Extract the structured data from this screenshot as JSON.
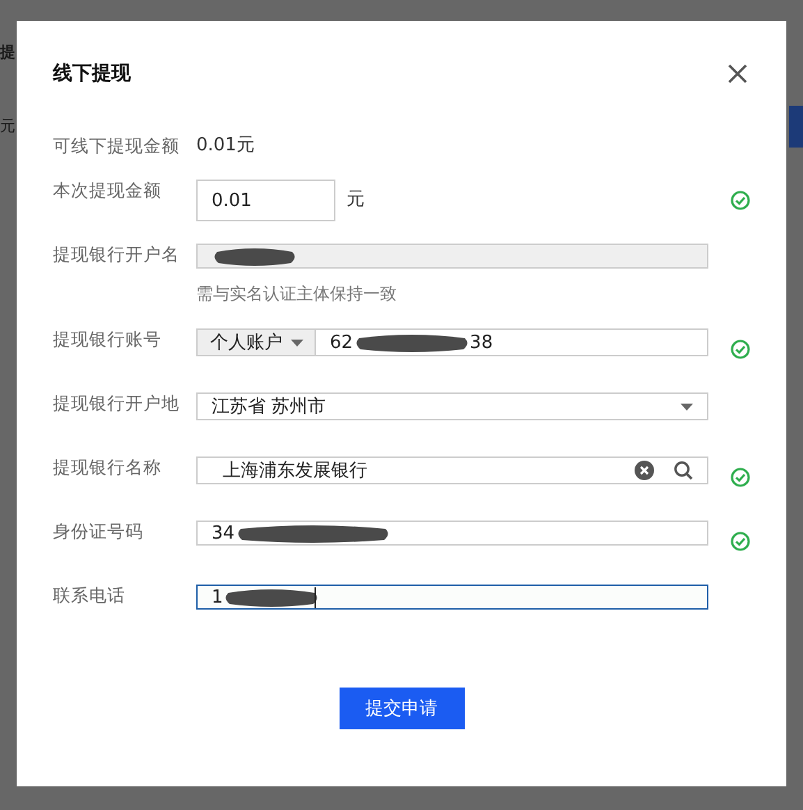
{
  "background": {
    "heading": "提",
    "amount_unit": "元"
  },
  "dialog": {
    "title": "线下提现"
  },
  "fields": [
    {
      "kind": "text",
      "label": "可线下提现金额",
      "value": "0.01元"
    },
    {
      "kind": "amount",
      "label": "本次提现金额",
      "value": "0.01",
      "unit": "元",
      "valid": true
    },
    {
      "kind": "readonly",
      "label": "提现银行开户名",
      "redacted": true,
      "hint": "需与实名认证主体保持一致",
      "valid": false
    },
    {
      "kind": "account",
      "label": "提现银行账号",
      "account_type": "个人账户",
      "value_start": "62",
      "redacted": true,
      "value_end": "38",
      "valid": true
    },
    {
      "kind": "select",
      "label": "提现银行开户地",
      "value": "江苏省 苏州市",
      "valid": false
    },
    {
      "kind": "search",
      "label": "提现银行名称",
      "value": "上海浦东发展银行",
      "valid": true
    },
    {
      "kind": "input",
      "label": "身份证号码",
      "value_start": "34",
      "redacted": true,
      "valid": true
    },
    {
      "kind": "input",
      "label": "联系电话",
      "value_start": "1",
      "redacted": true,
      "focused": true,
      "valid": false
    }
  ],
  "submit": "提交申请"
}
